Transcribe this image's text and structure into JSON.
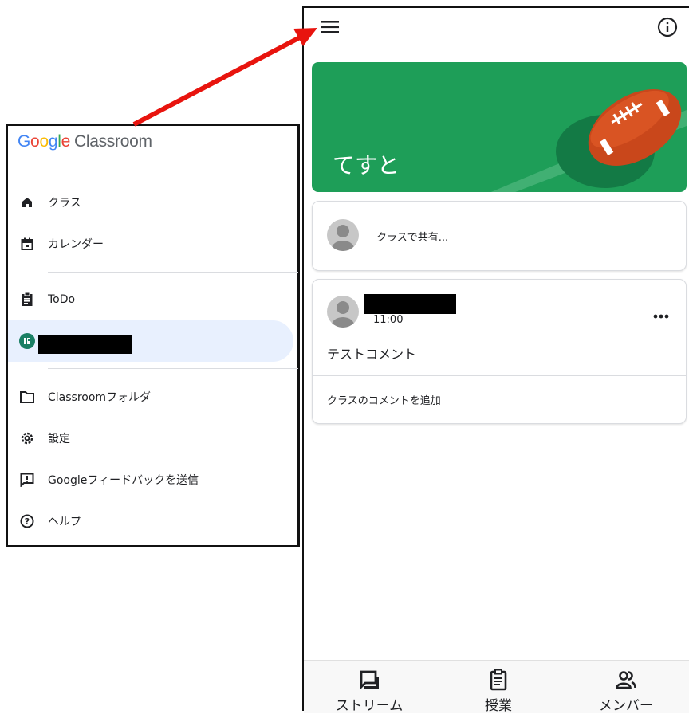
{
  "drawer": {
    "logo": {
      "google": [
        "G",
        "o",
        "o",
        "g",
        "l",
        "e"
      ],
      "product": "Classroom"
    },
    "items": [
      {
        "label": "クラス",
        "icon": "home-icon"
      },
      {
        "label": "カレンダー",
        "icon": "calendar-icon"
      },
      {
        "label": "ToDo",
        "icon": "clipboard-icon"
      },
      {
        "label": "",
        "icon": "class-avatar-icon",
        "active": true,
        "avatar_color": "#1a7f64"
      },
      {
        "label": "Classroomフォルダ",
        "icon": "folder-icon"
      },
      {
        "label": "設定",
        "icon": "gear-icon"
      },
      {
        "label": "Googleフィードバックを送信",
        "icon": "feedback-icon"
      },
      {
        "label": "ヘルプ",
        "icon": "help-icon"
      }
    ]
  },
  "screen": {
    "class_title": "てすと",
    "banner_color": "#1e9e58",
    "share_placeholder": "クラスで共有...",
    "post": {
      "time": "11:00",
      "body": "テストコメント",
      "add_comment": "クラスのコメントを追加"
    },
    "bottom_nav": [
      {
        "label": "ストリーム",
        "icon": "stream-icon"
      },
      {
        "label": "授業",
        "icon": "classwork-icon"
      },
      {
        "label": "メンバー",
        "icon": "people-icon"
      }
    ]
  },
  "colors": {
    "arrow": "#e8140e",
    "accent": "#1a73e8",
    "active_bg": "#e8f0fe"
  }
}
